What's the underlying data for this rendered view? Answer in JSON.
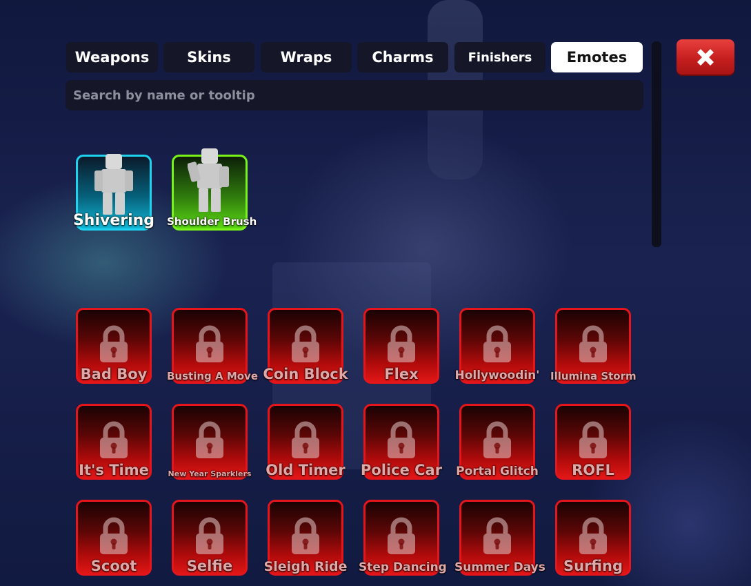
{
  "tabs": [
    {
      "label": "Weapons",
      "active": false
    },
    {
      "label": "Skins",
      "active": false
    },
    {
      "label": "Wraps",
      "active": false
    },
    {
      "label": "Charms",
      "active": false
    },
    {
      "label": "Finishers",
      "active": false
    },
    {
      "label": "Emotes",
      "active": true
    }
  ],
  "search": {
    "placeholder": "Search by name or tooltip",
    "value": ""
  },
  "close_icon": "close-x-icon",
  "owned_emotes": [
    {
      "name": "Shivering",
      "color": "#1fd2ef"
    },
    {
      "name": "Shoulder Brush",
      "color": "#79f31a"
    }
  ],
  "locked_emotes": [
    {
      "name": "Bad Boy"
    },
    {
      "name": "Busting A Move"
    },
    {
      "name": "Coin Block"
    },
    {
      "name": "Flex"
    },
    {
      "name": "Hollywoodin'"
    },
    {
      "name": "Illumina Storm"
    },
    {
      "name": "It's Time"
    },
    {
      "name": "New Year Sparklers"
    },
    {
      "name": "Old Timer"
    },
    {
      "name": "Police Car"
    },
    {
      "name": "Portal Glitch"
    },
    {
      "name": "ROFL"
    },
    {
      "name": "Scoot"
    },
    {
      "name": "Selfie"
    },
    {
      "name": "Sleigh Ride"
    },
    {
      "name": "Step Dancing"
    },
    {
      "name": "Summer Days"
    },
    {
      "name": "Surfing"
    }
  ],
  "colors": {
    "locked_border": "#e5161b",
    "active_tab": "#ffffff",
    "tab_bg": "#151628",
    "close_button": "#d42a2a"
  }
}
